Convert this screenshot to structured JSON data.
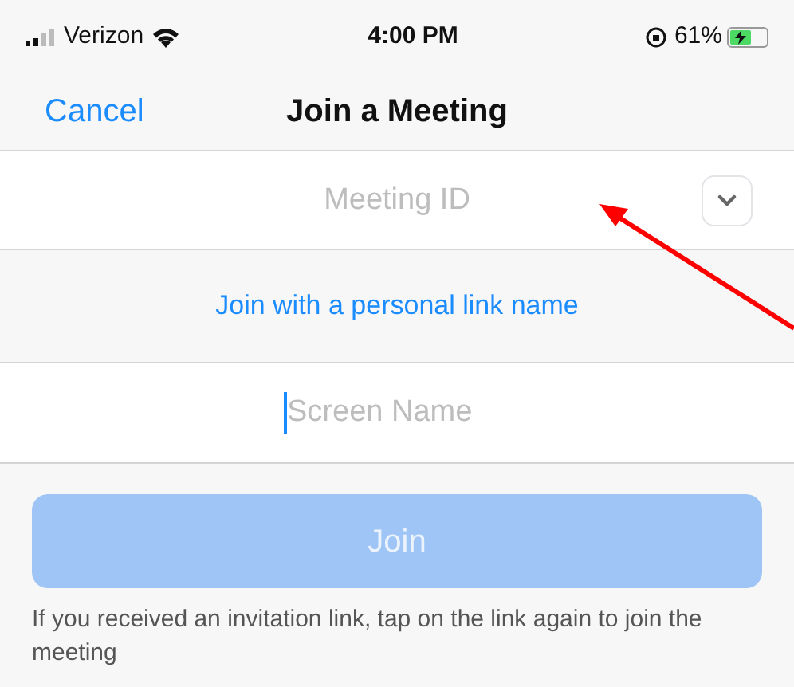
{
  "status_bar": {
    "carrier": "Verizon",
    "time": "4:00 PM",
    "battery": "61%",
    "charging": true
  },
  "nav": {
    "cancel": "Cancel",
    "title": "Join a Meeting"
  },
  "meeting_id": {
    "placeholder": "Meeting ID"
  },
  "personal_link": "Join with a personal link name",
  "screen_name": {
    "placeholder": "Screen Name"
  },
  "join_button": {
    "label": "Join",
    "disabled": true
  },
  "hint": "If you received an invitation link, tap on the link again to join the meeting"
}
